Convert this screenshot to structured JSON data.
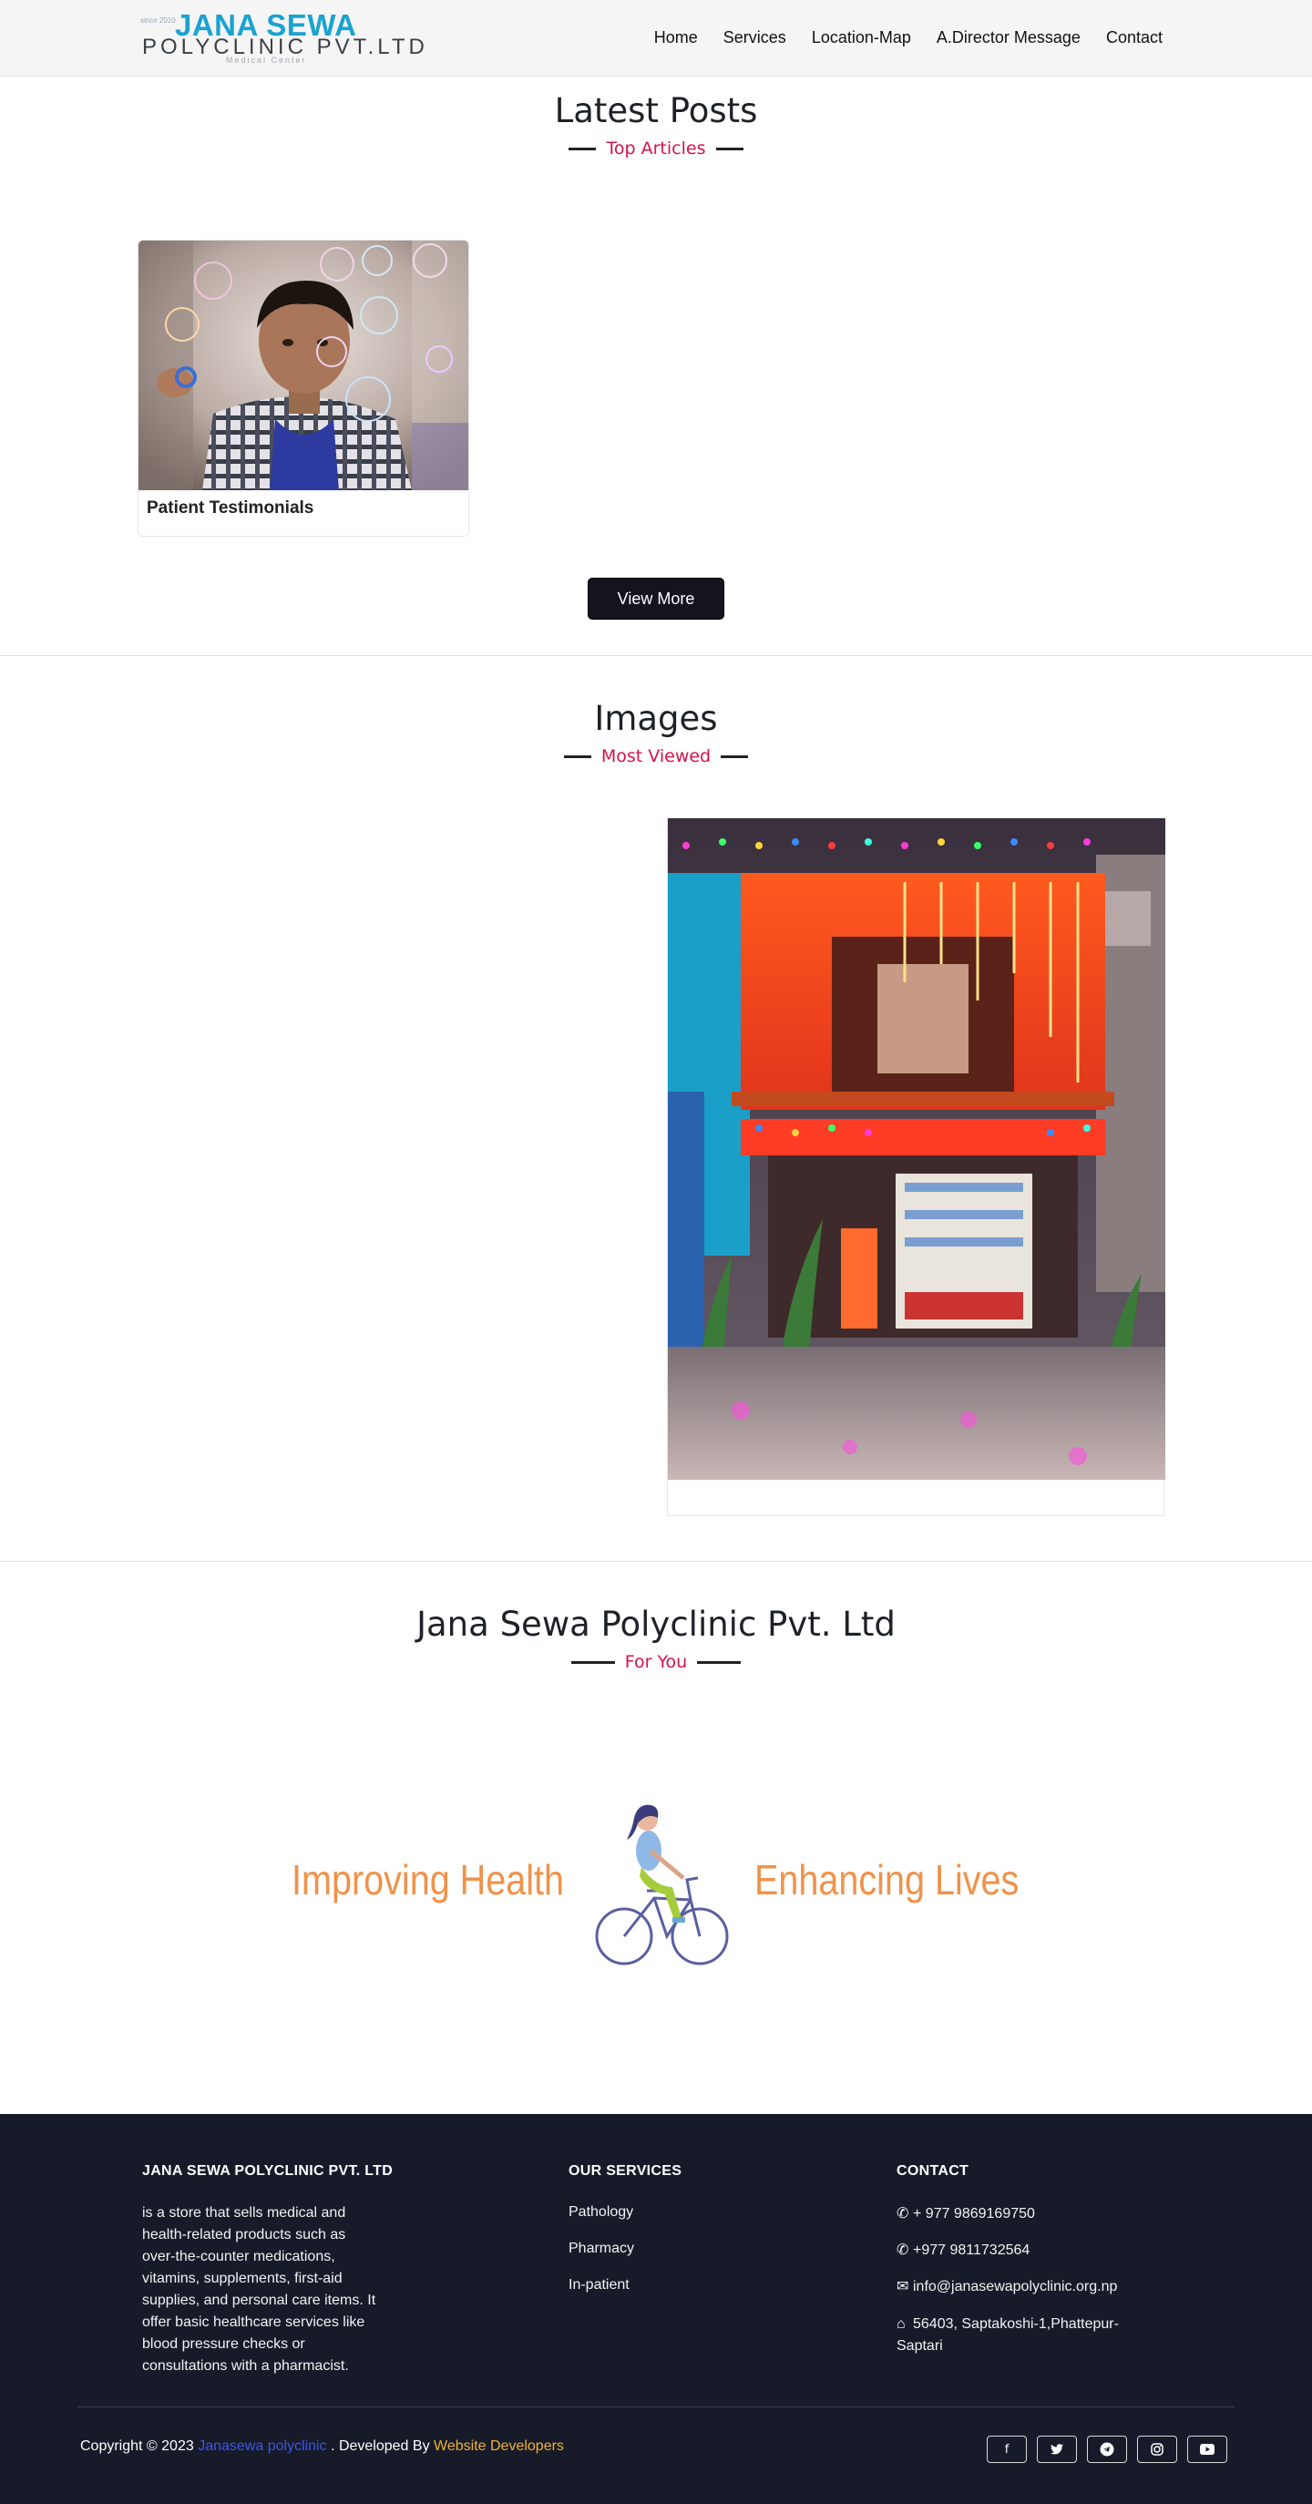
{
  "header": {
    "logo": {
      "since": "since 2010",
      "brand": "JANA SEWA",
      "sub": "POLYCLINIC PVT.LTD",
      "tag": "Medical Center"
    },
    "nav": [
      "Home",
      "Services",
      "Location-Map",
      "A.Director Message",
      "Contact"
    ]
  },
  "latest_posts": {
    "title": "Latest Posts",
    "subtitle": "Top Articles",
    "cards": [
      {
        "title": "Patient Testimonials",
        "image": "boy-with-soap-bubbles-photo"
      }
    ],
    "view_more": "View More"
  },
  "images": {
    "title": "Images",
    "subtitle": "Most Viewed",
    "photo": "pharmacy-storefront-with-festival-lights"
  },
  "about": {
    "title": "Jana Sewa Polyclinic Pvt. Ltd",
    "subtitle": "For You",
    "banner_left": "Improving Health",
    "banner_right": "Enhancing Lives",
    "illustration": "woman-cycling-illustration"
  },
  "footer": {
    "col1": {
      "heading": "JANA SEWA POLYCLINIC PVT. LTD",
      "lines": [
        "is a store that sells medical and",
        "health-related products such as",
        "over-the-counter medications,",
        "vitamins, supplements, first-aid",
        "supplies, and personal care items. It",
        "offer basic healthcare services like",
        "blood pressure checks or",
        "consultations with a pharmacist."
      ]
    },
    "col2": {
      "heading": "OUR SERVICES",
      "items": [
        "Pathology",
        "Pharmacy",
        "In-patient"
      ]
    },
    "col3": {
      "heading": "CONTACT",
      "phone1": "+ 977 9869169750",
      "phone2": "+977 9811732564",
      "email": "info@janasewapolyclinic.org.np",
      "address_line1": "56403, Saptakoshi-1,Phattepur-",
      "address_line2": "Saptari"
    },
    "copyright_prefix": "Copyright © 2023",
    "copyright_link": "Janasewa polyclinic",
    "developed_by": ". Developed By",
    "developer_link": "Website Developers",
    "socials": [
      "facebook-icon",
      "twitter-icon",
      "telegram-icon",
      "instagram-icon",
      "youtube-icon"
    ]
  },
  "colors": {
    "accent_red": "#d6124a",
    "brand_blue": "#1aa3d0",
    "banner_orange": "#f0924a",
    "footer_bg": "#171b29"
  }
}
